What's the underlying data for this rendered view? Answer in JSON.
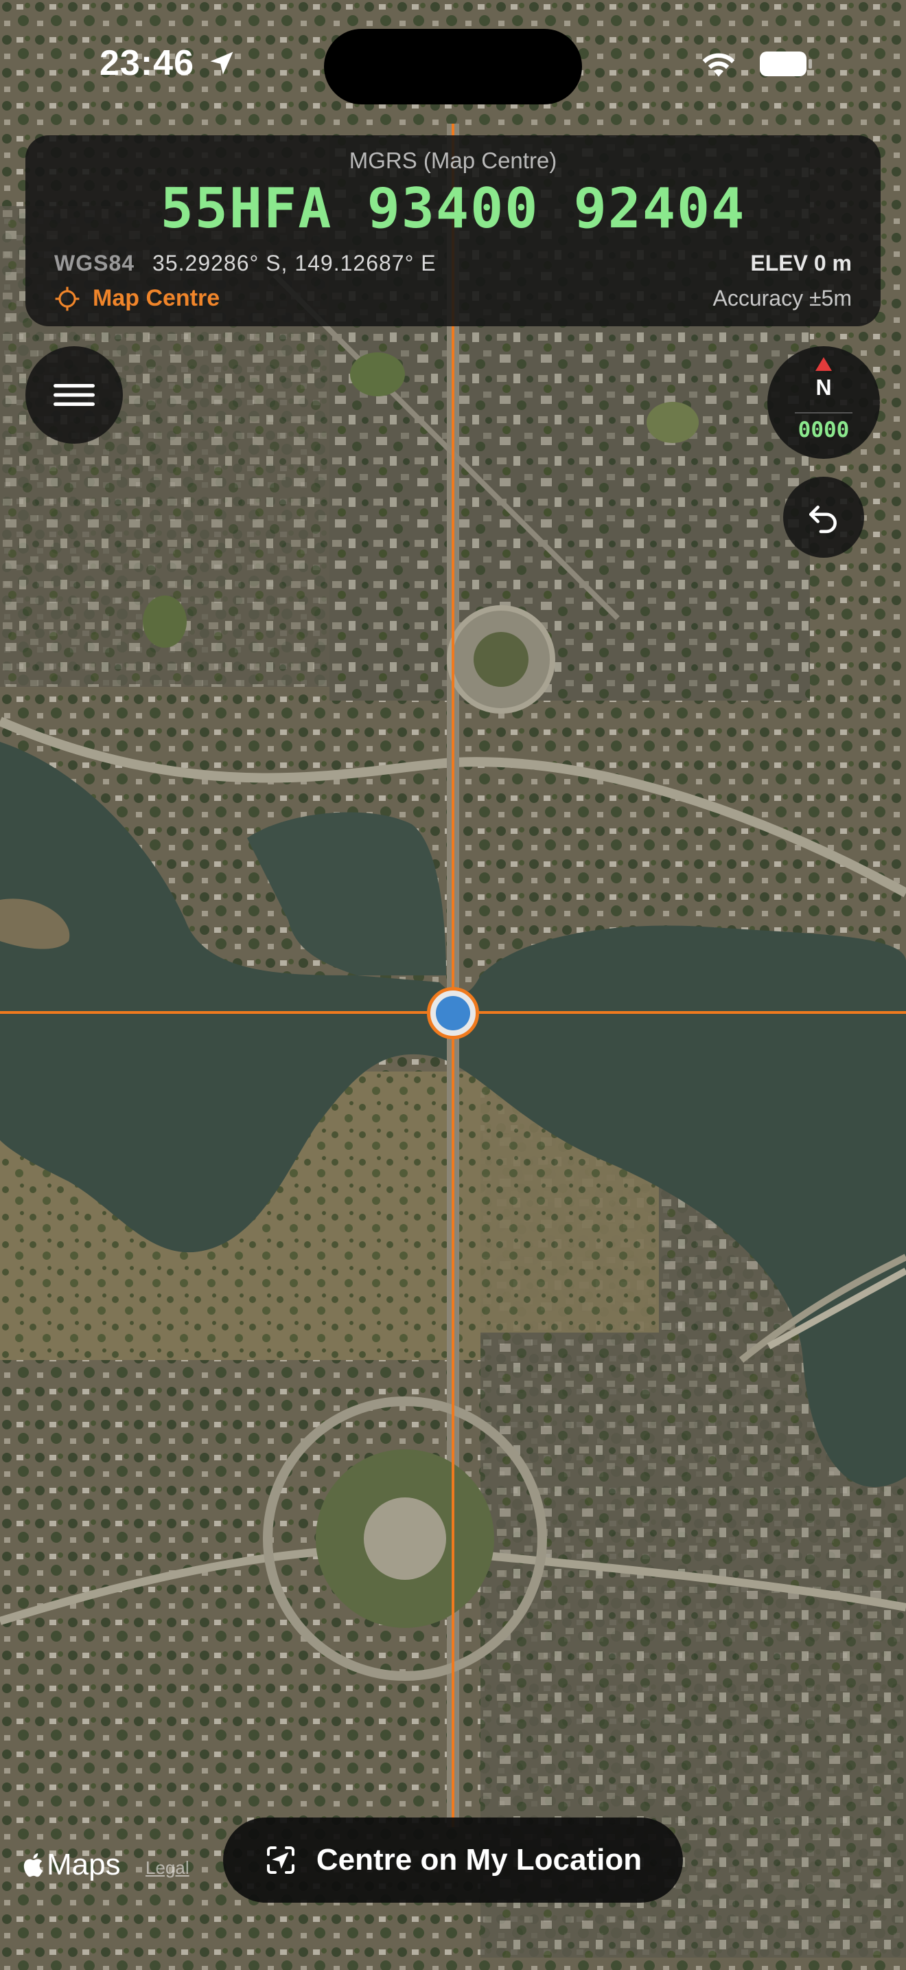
{
  "status_bar": {
    "time": "23:46",
    "icons": [
      "location-arrow-icon",
      "wifi-icon",
      "battery-icon"
    ]
  },
  "mgrs_panel": {
    "title": "MGRS (Map Centre)",
    "coordinate": "55HFA 93400 92404",
    "datum": "WGS84",
    "latlon": "35.29286° S, 149.12687° E",
    "elevation": "ELEV 0 m",
    "mode": "Map Centre",
    "accuracy": "Accuracy ±5m"
  },
  "compass": {
    "north": "N",
    "bearing": "0000"
  },
  "buttons": {
    "menu_icon": "hamburger-icon",
    "undo_icon": "undo-icon",
    "centre_label": "Centre on My Location"
  },
  "map": {
    "attribution": "Maps",
    "legal": "Legal"
  },
  "colors": {
    "accent_orange": "#f07a1e",
    "coord_green": "#8be88d",
    "location_blue": "#3d86d0"
  }
}
